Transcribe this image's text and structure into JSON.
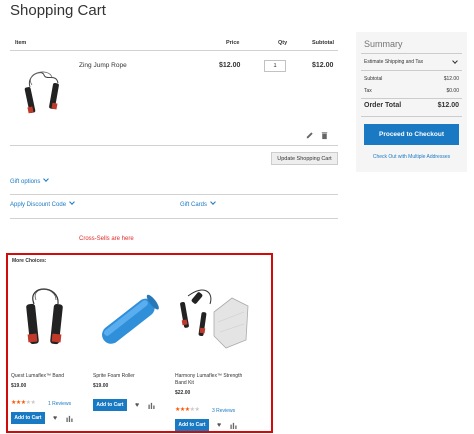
{
  "page": {
    "title": "Shopping Cart"
  },
  "cart": {
    "headers": {
      "item": "Item",
      "price": "Price",
      "qty": "Qty",
      "subtotal": "Subtotal"
    },
    "item": {
      "name": "Zing Jump Rope",
      "price": "$12.00",
      "qty": "1",
      "subtotal": "$12.00"
    },
    "update_label": "Update Shopping Cart",
    "gift_options": "Gift options",
    "discount": "Apply Discount Code",
    "gift_cards": "Gift Cards"
  },
  "summary": {
    "title": "Summary",
    "estimate": "Estimate Shipping and Tax",
    "subtotal_label": "Subtotal",
    "subtotal_value": "$12.00",
    "tax_label": "Tax",
    "tax_value": "$0.00",
    "order_total_label": "Order Total",
    "order_total_value": "$12.00",
    "checkout_label": "Proceed to Checkout",
    "multi_label": "Check Out with Multiple Addresses"
  },
  "annotation": "Cross-Sells are here",
  "crosssell": {
    "heading": "More Choices:",
    "add_label": "Add to Cart",
    "items": [
      {
        "name": "Quest Lumaflex™ Band",
        "price": "$19.00",
        "rating": 3,
        "reviews": "1  Reviews"
      },
      {
        "name": "Sprite Foam Roller",
        "price": "$19.00",
        "rating": 0,
        "reviews": ""
      },
      {
        "name": "Harmony Lumaflex™ Strength Band Kit",
        "price": "$22.00",
        "rating": 3,
        "reviews": "3  Reviews"
      }
    ]
  },
  "colors": {
    "accent": "#1979c3",
    "highlight_border": "#d10a0a",
    "annotation": "#e02b27",
    "star": "#ff5501"
  },
  "icons": [
    "edit-icon",
    "trash-icon",
    "chevron-down-icon",
    "heart-icon",
    "compare-icon"
  ]
}
